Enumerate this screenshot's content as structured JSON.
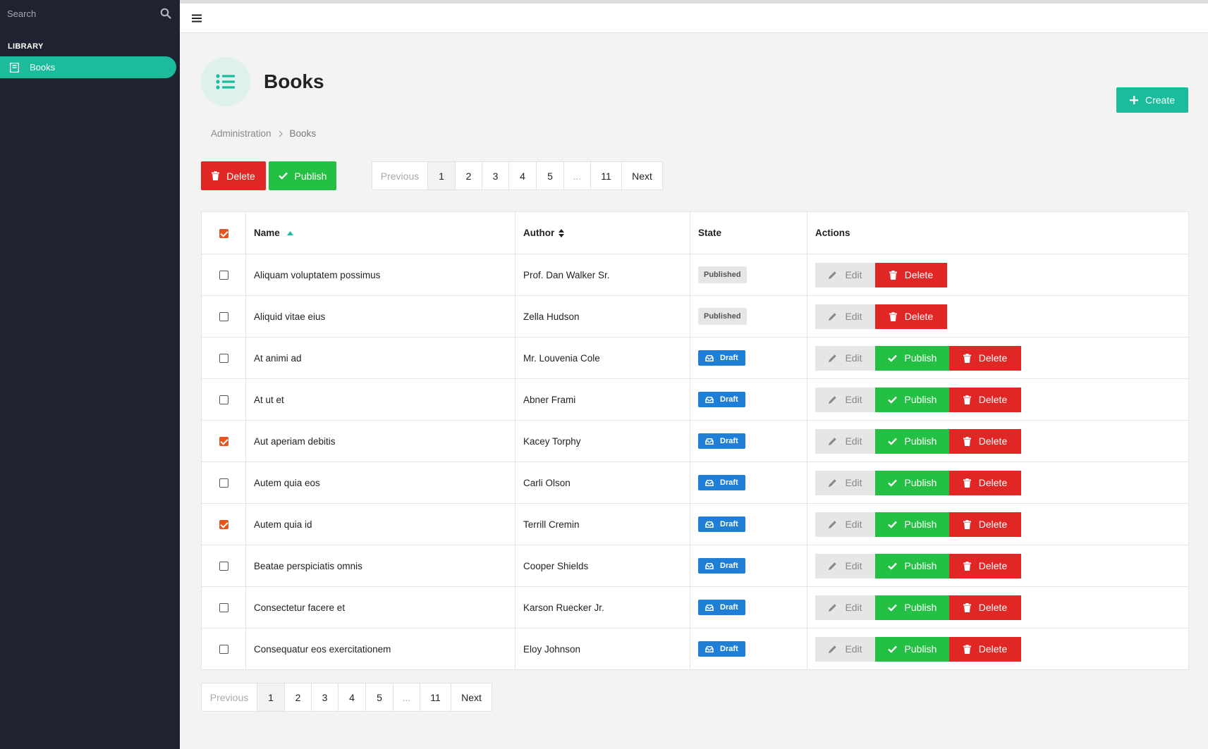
{
  "sidebar": {
    "search_placeholder": "Search",
    "section": "LIBRARY",
    "items": [
      {
        "label": "Books",
        "icon": "book-icon",
        "active": true
      }
    ]
  },
  "page": {
    "title": "Books",
    "create_label": "Create",
    "breadcrumb": [
      "Administration",
      "Books"
    ]
  },
  "bulk": {
    "delete_label": "Delete",
    "publish_label": "Publish"
  },
  "pagination": {
    "previous": "Previous",
    "pages": [
      "1",
      "2",
      "3",
      "4",
      "5",
      "...",
      "11"
    ],
    "current": "1",
    "next": "Next"
  },
  "table": {
    "headers": {
      "name": "Name",
      "author": "Author",
      "state": "State",
      "actions": "Actions"
    },
    "all_checked": true,
    "action_labels": {
      "edit": "Edit",
      "publish": "Publish",
      "delete": "Delete"
    },
    "rows": [
      {
        "name": "Aliquam voluptatem possimus",
        "author": "Prof. Dan Walker Sr.",
        "state": "Published",
        "checked": false
      },
      {
        "name": "Aliquid vitae eius",
        "author": "Zella Hudson",
        "state": "Published",
        "checked": false
      },
      {
        "name": "At animi ad",
        "author": "Mr. Louvenia Cole",
        "state": "Draft",
        "checked": false
      },
      {
        "name": "At ut et",
        "author": "Abner Frami",
        "state": "Draft",
        "checked": false
      },
      {
        "name": "Aut aperiam debitis",
        "author": "Kacey Torphy",
        "state": "Draft",
        "checked": true
      },
      {
        "name": "Autem quia eos",
        "author": "Carli Olson",
        "state": "Draft",
        "checked": false
      },
      {
        "name": "Autem quia id",
        "author": "Terrill Cremin",
        "state": "Draft",
        "checked": true
      },
      {
        "name": "Beatae perspiciatis omnis",
        "author": "Cooper Shields",
        "state": "Draft",
        "checked": false
      },
      {
        "name": "Consectetur facere et",
        "author": "Karson Ruecker Jr.",
        "state": "Draft",
        "checked": false
      },
      {
        "name": "Consequatur eos exercitationem",
        "author": "Eloy Johnson",
        "state": "Draft",
        "checked": false
      }
    ]
  },
  "colors": {
    "accent": "#1abc9c",
    "danger": "#e12626",
    "success": "#24c044",
    "draft": "#1f7fd6",
    "sidebar": "#1f2230"
  }
}
